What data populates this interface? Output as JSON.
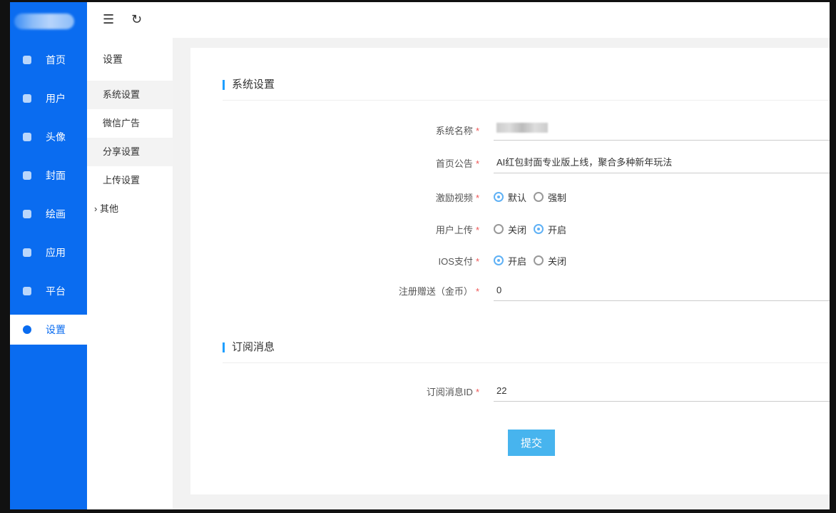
{
  "sidebar": {
    "items": [
      "首页",
      "用户",
      "头像",
      "封面",
      "绘画",
      "应用",
      "平台",
      "设置"
    ],
    "active": 7
  },
  "submenu": {
    "title": "设置",
    "items": [
      "系统设置",
      "微信广告",
      "分享设置",
      "上传设置"
    ],
    "other": "其他"
  },
  "sections": {
    "system": "系统设置",
    "subscribe": "订阅消息"
  },
  "form": {
    "system_name": {
      "label": "系统名称",
      "value": ""
    },
    "notice": {
      "label": "首页公告",
      "value": "AI红包封面专业版上线，聚合多种新年玩法"
    },
    "video": {
      "label": "激励视频",
      "opt1": "默认",
      "opt2": "强制",
      "selected": "默认"
    },
    "upload": {
      "label": "用户上传",
      "opt1": "关闭",
      "opt2": "开启",
      "selected": "开启"
    },
    "ios": {
      "label": "IOS支付",
      "opt1": "开启",
      "opt2": "关闭",
      "selected": "开启"
    },
    "gift": {
      "label": "注册赠送（金币）",
      "value": "0"
    },
    "sub_id": {
      "label": "订阅消息ID",
      "value": "22"
    },
    "required_mark": "*"
  },
  "submit": "提交"
}
